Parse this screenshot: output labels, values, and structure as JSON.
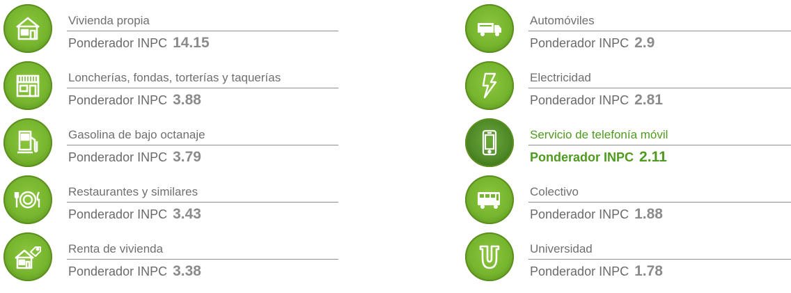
{
  "prefix": "Ponderador INPC",
  "colors": {
    "accent": "#76b52e",
    "active_text": "#4e9a1e",
    "text": "#6f6f6f"
  },
  "left": [
    {
      "label": "Vivienda propia",
      "value": "14.15",
      "icon": "house-icon"
    },
    {
      "label": "Loncherías, fondas, torterías y taquerías",
      "value": "3.88",
      "icon": "storefront-icon"
    },
    {
      "label": "Gasolina de bajo octanaje",
      "value": "3.79",
      "icon": "gas-pump-icon"
    },
    {
      "label": "Restaurantes y similares",
      "value": "3.43",
      "icon": "plate-fork-knife-icon"
    },
    {
      "label": "Renta de vivienda",
      "value": "3.38",
      "icon": "house-for-rent-icon"
    }
  ],
  "right": [
    {
      "label": "Automóviles",
      "value": "2.9",
      "icon": "truck-icon"
    },
    {
      "label": "Electricidad",
      "value": "2.81",
      "icon": "lightning-icon"
    },
    {
      "label": "Servicio de telefonía móvil",
      "value": "2.11",
      "icon": "mobile-phone-icon",
      "active": true
    },
    {
      "label": "Colectivo",
      "value": "1.88",
      "icon": "bus-icon"
    },
    {
      "label": "Universidad",
      "value": "1.78",
      "icon": "university-icon"
    }
  ]
}
